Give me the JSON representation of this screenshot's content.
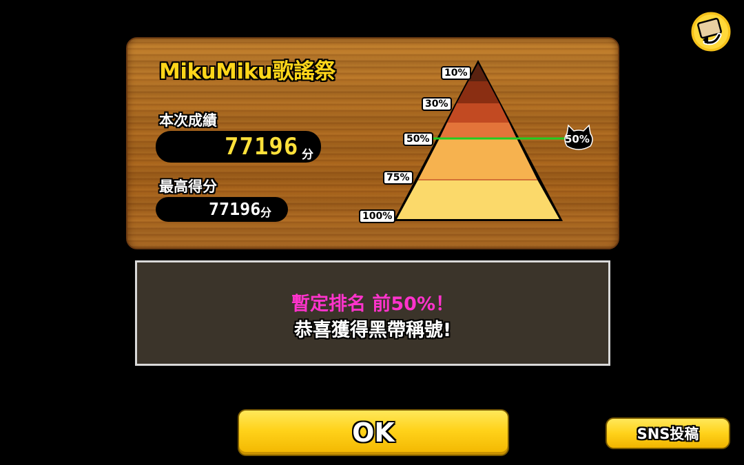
{
  "event": {
    "title": "MikuMiku歌謠祭"
  },
  "current_score": {
    "label": "本次成績",
    "value": "77196",
    "unit": "分"
  },
  "best_score": {
    "label": "最高得分",
    "value": "77196",
    "unit": "分"
  },
  "pyramid": {
    "tiers": [
      "10%",
      "30%",
      "50%",
      "75%",
      "100%"
    ],
    "player_marker": "50%",
    "player_rank_fraction": 0.5
  },
  "message": {
    "line1": "暫定排名 前50%！",
    "line2": "恭喜獲得黑帶稱號!"
  },
  "buttons": {
    "ok": "OK",
    "sns": "SNS投稿"
  },
  "colors": {
    "title": "#ffd61a",
    "rank_text": "#ff33cc",
    "player_line": "#22cc22",
    "button": "#ffd21a"
  }
}
